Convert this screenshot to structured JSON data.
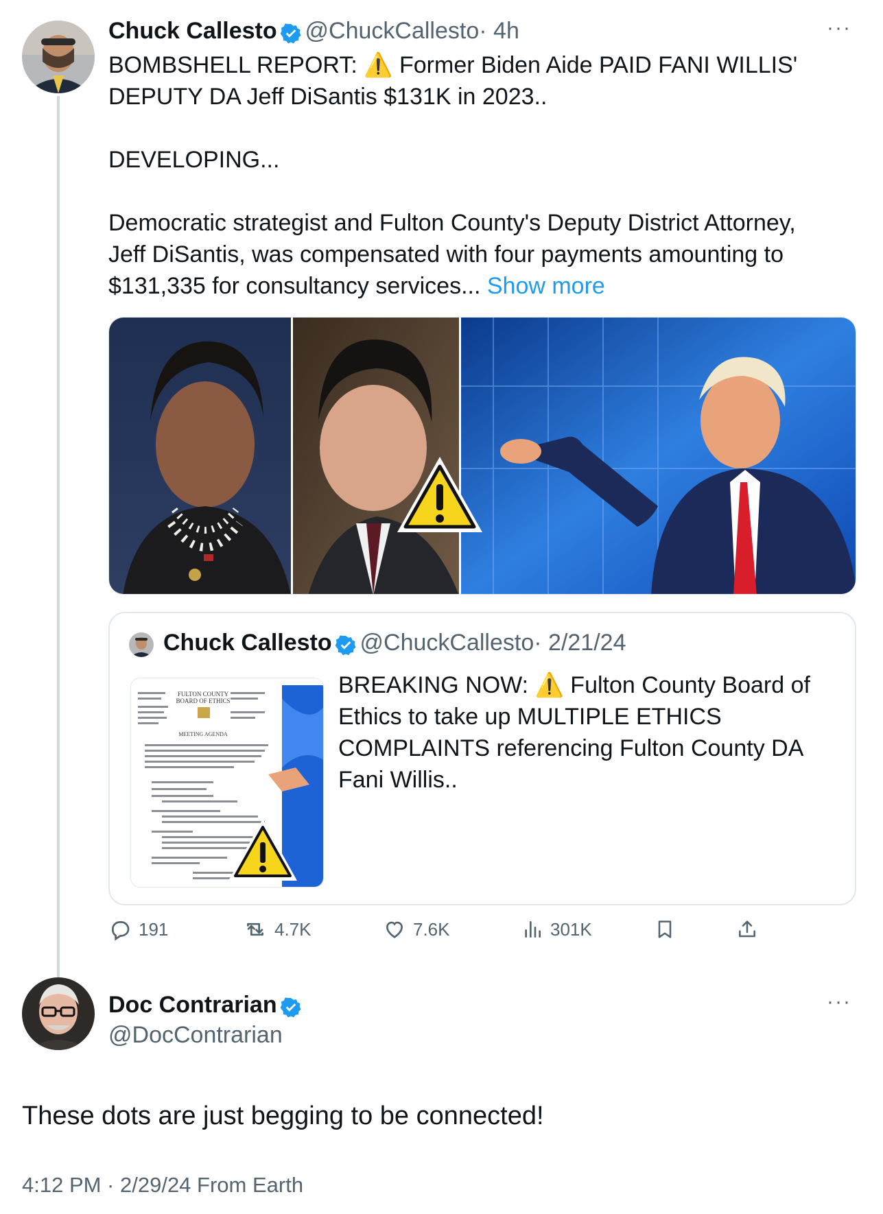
{
  "tweet": {
    "author_name": "Chuck Callesto",
    "author_handle": "@ChuckCallesto",
    "time": "· 4h",
    "text_line1": "BOMBSHELL REPORT: ⚠️ Former Biden Aide PAID FANI WILLIS'",
    "text_line2": "DEPUTY DA Jeff DiSantis $131K in 2023..",
    "text_line3": "DEVELOPING...",
    "text_line4": "Democratic strategist and Fulton County's Deputy District Attorney,",
    "text_line5": "Jeff DiSantis, was compensated with four payments amounting to",
    "text_line6": "$131,335 for consultancy services...",
    "show_more": "Show more"
  },
  "quote": {
    "author_name": "Chuck Callesto",
    "author_handle": "@ChuckCallesto",
    "date": "· 2/21/24",
    "text_line1": "BREAKING NOW: ⚠️  Fulton County Board of",
    "text_line2": "Ethics to take up MULTIPLE ETHICS",
    "text_line3": "COMPLAINTS referencing Fulton County DA",
    "text_line4": "Fani Willis..",
    "doc_heading1": "FULTON COUNTY",
    "doc_heading2": "BOARD OF ETHICS",
    "doc_subheading": "MEETING AGENDA"
  },
  "actions": {
    "replies": "191",
    "reposts": "4.7K",
    "likes": "7.6K",
    "views": "301K"
  },
  "reply": {
    "author_name": "Doc Contrarian",
    "author_handle": "@DocContrarian",
    "text": "These dots are just begging to be connected!",
    "timestamp": "4:12 PM · 2/29/24 From Earth"
  },
  "colors": {
    "accent": "#1d9bf0",
    "secondary_text": "#536471",
    "warning_yellow": "#f7d51d"
  }
}
